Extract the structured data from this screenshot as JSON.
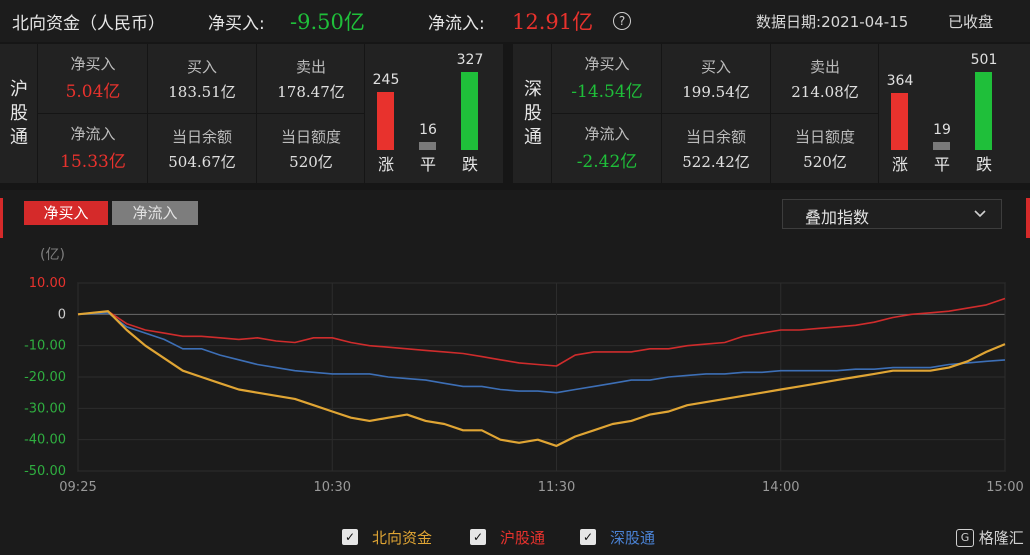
{
  "header": {
    "title": "北向资金（人民币）",
    "net_buy_label": "净买入:",
    "net_buy_value": "-9.50亿",
    "net_inflow_label": "净流入:",
    "net_inflow_value": "12.91亿",
    "help_symbol": "?",
    "data_date_label": "数据日期:",
    "data_date_value": "2021-04-15",
    "status": "已收盘"
  },
  "sh": {
    "name": [
      "沪",
      "股",
      "通"
    ],
    "net_buy_label": "净买入",
    "net_buy_value": "5.04亿",
    "net_inflow_label": "净流入",
    "net_inflow_value": "15.33亿",
    "buy_label": "买入",
    "buy_value": "183.51亿",
    "sell_label": "卖出",
    "sell_value": "178.47亿",
    "balance_label": "当日余额",
    "balance_value": "504.67亿",
    "quota_label": "当日额度",
    "quota_value": "520亿",
    "up_count": "245",
    "flat_count": "16",
    "down_count": "327",
    "up_label": "涨",
    "flat_label": "平",
    "down_label": "跌"
  },
  "sz": {
    "name": [
      "深",
      "股",
      "通"
    ],
    "net_buy_label": "净买入",
    "net_buy_value": "-14.54亿",
    "net_inflow_label": "净流入",
    "net_inflow_value": "-2.42亿",
    "buy_label": "买入",
    "buy_value": "199.54亿",
    "sell_label": "卖出",
    "sell_value": "214.08亿",
    "balance_label": "当日余额",
    "balance_value": "522.42亿",
    "quota_label": "当日额度",
    "quota_value": "520亿",
    "up_count": "364",
    "flat_count": "19",
    "down_count": "501",
    "up_label": "涨",
    "flat_label": "平",
    "down_label": "跌"
  },
  "colors": {
    "up": "#e8322d",
    "down": "#1fbf3a",
    "flat": "#7a7a7a",
    "northbound_line": "#e0a534",
    "sh_line": "#cf2c2c",
    "sz_line": "#3d6fb6"
  },
  "tabs": {
    "active": "净买入",
    "inactive": "净流入"
  },
  "dropdown": {
    "label": "叠加指数",
    "chevron_icon": "chevron-down-icon"
  },
  "chart_data": {
    "type": "line",
    "ylabel": "(亿)",
    "ylim": [
      -50,
      10
    ],
    "yticks": [
      "10.00",
      "0",
      "-10.00",
      "-20.00",
      "-30.00",
      "-40.00",
      "-50.00"
    ],
    "xticks": [
      "09:25",
      "10:30",
      "11:30",
      "14:00",
      "15:00"
    ],
    "grid": true,
    "x": [
      "09:25",
      "09:30",
      "09:35",
      "09:40",
      "09:45",
      "09:50",
      "09:55",
      "10:00",
      "10:05",
      "10:10",
      "10:15",
      "10:20",
      "10:25",
      "10:30",
      "10:35",
      "10:40",
      "10:45",
      "10:50",
      "10:55",
      "11:00",
      "11:05",
      "11:10",
      "11:15",
      "11:20",
      "11:25",
      "11:30",
      "13:05",
      "13:10",
      "13:15",
      "13:20",
      "13:25",
      "13:30",
      "13:35",
      "13:40",
      "13:45",
      "13:50",
      "13:55",
      "14:00",
      "14:05",
      "14:10",
      "14:15",
      "14:20",
      "14:25",
      "14:30",
      "14:35",
      "14:40",
      "14:45",
      "14:50",
      "14:55",
      "15:00"
    ],
    "series": [
      {
        "name": "北向资金",
        "values": [
          0,
          1,
          -5,
          -10,
          -14,
          -18,
          -20,
          -22,
          -24,
          -25,
          -26,
          -27,
          -29,
          -31,
          -33,
          -34,
          -33,
          -32,
          -34,
          -35,
          -37,
          -37,
          -40,
          -41,
          -40,
          -42,
          -39,
          -37,
          -35,
          -34,
          -32,
          -31,
          -29,
          -28,
          -27,
          -26,
          -25,
          -24,
          -23,
          -22,
          -21,
          -20,
          -19,
          -18,
          -18,
          -18,
          -17,
          -15,
          -12,
          -9.5
        ]
      },
      {
        "name": "沪股通",
        "values": [
          0,
          1,
          -3,
          -5,
          -6,
          -7,
          -7,
          -7.5,
          -8,
          -7.5,
          -8.5,
          -9,
          -7.5,
          -7.5,
          -9,
          -10,
          -10.5,
          -11,
          -11.5,
          -12,
          -12.5,
          -13.5,
          -14.5,
          -15.5,
          -16,
          -16.5,
          -13,
          -12,
          -12,
          -12,
          -11,
          -11,
          -10,
          -9.5,
          -9,
          -7,
          -6,
          -5,
          -5,
          -4.5,
          -4,
          -3.5,
          -2.5,
          -1,
          0,
          0.5,
          1,
          2,
          3,
          5.04
        ]
      },
      {
        "name": "深股通",
        "values": [
          0,
          0.5,
          -4,
          -6,
          -8,
          -11,
          -11,
          -13,
          -14.5,
          -16,
          -17,
          -18,
          -18.5,
          -19,
          -19,
          -19,
          -20,
          -20.5,
          -21,
          -22,
          -23,
          -23,
          -24,
          -24.5,
          -24.5,
          -25,
          -24,
          -23,
          -22,
          -21,
          -21,
          -20,
          -19.5,
          -19,
          -19,
          -18.5,
          -18.5,
          -18,
          -18,
          -18,
          -18,
          -17.5,
          -17.5,
          -17,
          -17,
          -17,
          -16,
          -15.5,
          -15,
          -14.54
        ]
      }
    ]
  },
  "legend": {
    "check_symbol": "✓",
    "items": [
      "北向资金",
      "沪股通",
      "深股通"
    ]
  },
  "logo": {
    "text": "格隆汇"
  }
}
